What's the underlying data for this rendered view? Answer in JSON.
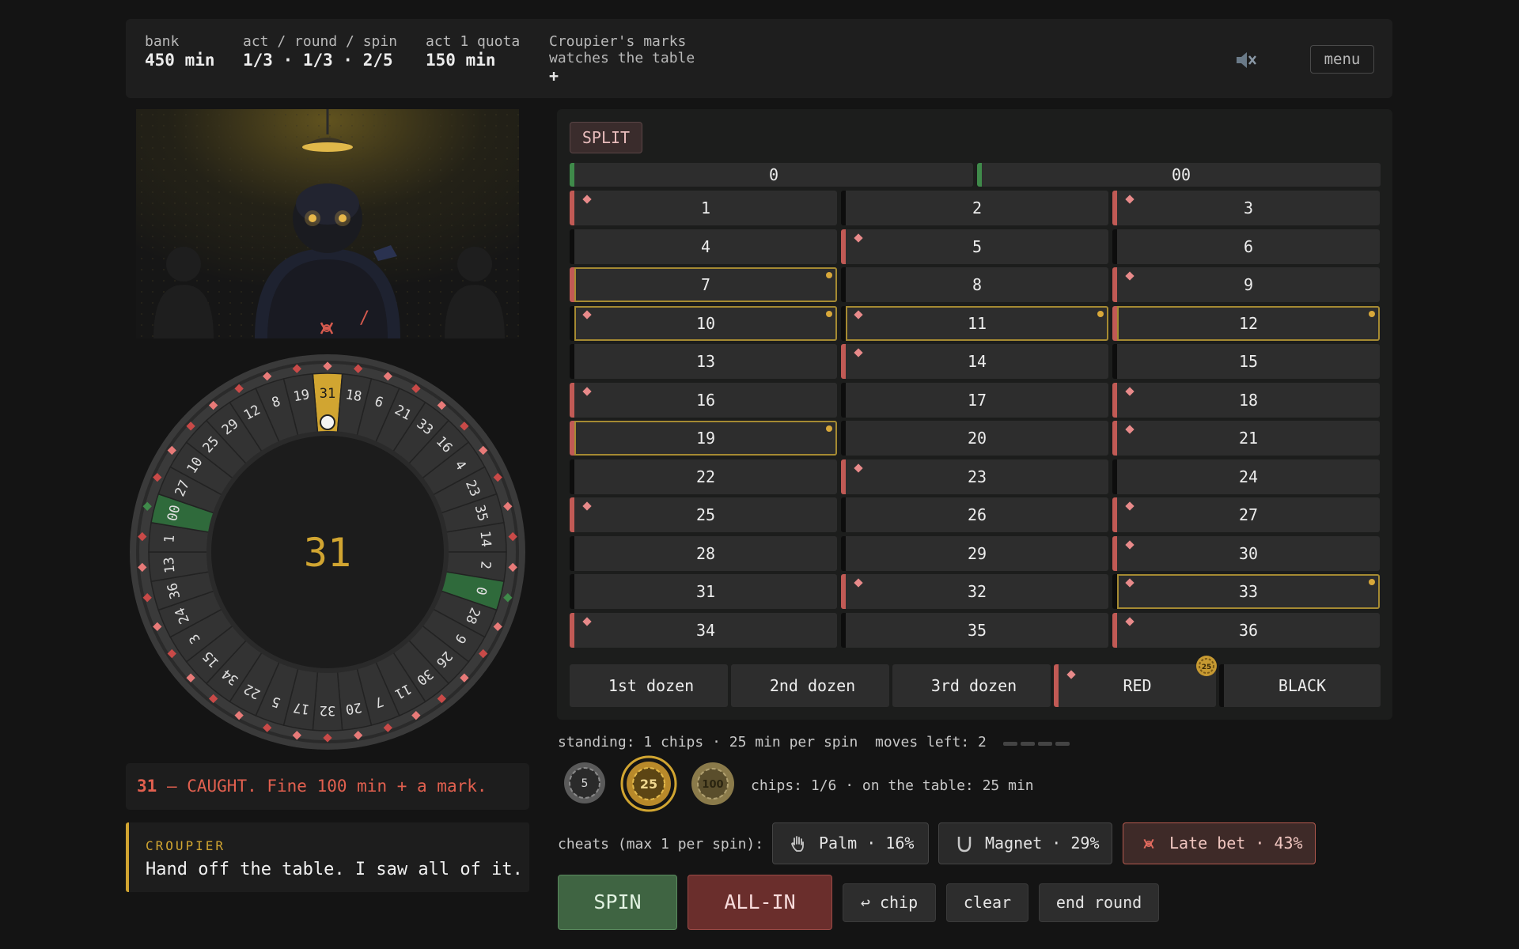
{
  "topbar": {
    "bank_label": "bank",
    "bank_value": "450 min",
    "progress_label": "act / round / spin",
    "progress_value": "1/3 · 1/3 · 2/5",
    "quota_label": "act 1 quota",
    "quota_value": "150 min",
    "marks_label": "Croupier's marks",
    "marks_status": "watches the table",
    "marks_symbol": "+",
    "sound_icon": "speaker-muted-icon",
    "menu_label": "menu"
  },
  "scene": {
    "late_bet_marker_icon": "late-bet-icon",
    "slash_text": "/"
  },
  "wheel": {
    "center_number": "31",
    "highlighted": "31",
    "pockets": [
      "31",
      "18",
      "6",
      "21",
      "33",
      "16",
      "4",
      "23",
      "35",
      "14",
      "2",
      "0",
      "28",
      "9",
      "26",
      "30",
      "11",
      "7",
      "20",
      "32",
      "17",
      "5",
      "22",
      "34",
      "15",
      "3",
      "24",
      "36",
      "13",
      "1",
      "00",
      "27",
      "10",
      "25",
      "29",
      "12",
      "8",
      "19"
    ],
    "greens": [
      "0",
      "00"
    ],
    "colors": {
      "gold": "#d1a531",
      "red": "#c94a48",
      "green": "#2f6a3b",
      "rim": "#3b3b3b"
    }
  },
  "result": {
    "number": "31",
    "text": " — CAUGHT. Fine 100 min + a mark."
  },
  "croupier": {
    "label": "CROUPIER",
    "line": "Hand off the table. I saw all of it."
  },
  "board": {
    "mode_label": "SPLIT",
    "zero": "0",
    "double_zero": "00",
    "cells": [
      {
        "n": "1",
        "color": "red",
        "mark": true,
        "sel": false
      },
      {
        "n": "2",
        "color": "black",
        "mark": false,
        "sel": false
      },
      {
        "n": "3",
        "color": "red",
        "mark": true,
        "sel": false
      },
      {
        "n": "4",
        "color": "black",
        "mark": false,
        "sel": false
      },
      {
        "n": "5",
        "color": "red",
        "mark": true,
        "sel": false
      },
      {
        "n": "6",
        "color": "black",
        "mark": false,
        "sel": false
      },
      {
        "n": "7",
        "color": "red",
        "mark": false,
        "sel": true
      },
      {
        "n": "8",
        "color": "black",
        "mark": false,
        "sel": false
      },
      {
        "n": "9",
        "color": "red",
        "mark": true,
        "sel": false
      },
      {
        "n": "10",
        "color": "black",
        "mark": true,
        "sel": true
      },
      {
        "n": "11",
        "color": "black",
        "mark": true,
        "sel": true
      },
      {
        "n": "12",
        "color": "red",
        "mark": false,
        "sel": true
      },
      {
        "n": "13",
        "color": "black",
        "mark": false,
        "sel": false
      },
      {
        "n": "14",
        "color": "red",
        "mark": true,
        "sel": false
      },
      {
        "n": "15",
        "color": "black",
        "mark": false,
        "sel": false
      },
      {
        "n": "16",
        "color": "red",
        "mark": true,
        "sel": false
      },
      {
        "n": "17",
        "color": "black",
        "mark": false,
        "sel": false
      },
      {
        "n": "18",
        "color": "red",
        "mark": true,
        "sel": false
      },
      {
        "n": "19",
        "color": "red",
        "mark": false,
        "sel": true
      },
      {
        "n": "20",
        "color": "black",
        "mark": false,
        "sel": false
      },
      {
        "n": "21",
        "color": "red",
        "mark": true,
        "sel": false
      },
      {
        "n": "22",
        "color": "black",
        "mark": false,
        "sel": false
      },
      {
        "n": "23",
        "color": "red",
        "mark": true,
        "sel": false
      },
      {
        "n": "24",
        "color": "black",
        "mark": false,
        "sel": false
      },
      {
        "n": "25",
        "color": "red",
        "mark": true,
        "sel": false
      },
      {
        "n": "26",
        "color": "black",
        "mark": false,
        "sel": false
      },
      {
        "n": "27",
        "color": "red",
        "mark": true,
        "sel": false
      },
      {
        "n": "28",
        "color": "black",
        "mark": false,
        "sel": false
      },
      {
        "n": "29",
        "color": "black",
        "mark": false,
        "sel": false
      },
      {
        "n": "30",
        "color": "red",
        "mark": true,
        "sel": false
      },
      {
        "n": "31",
        "color": "black",
        "mark": false,
        "sel": false
      },
      {
        "n": "32",
        "color": "red",
        "mark": true,
        "sel": false
      },
      {
        "n": "33",
        "color": "black",
        "mark": true,
        "sel": true
      },
      {
        "n": "34",
        "color": "red",
        "mark": true,
        "sel": false
      },
      {
        "n": "35",
        "color": "black",
        "mark": false,
        "sel": false
      },
      {
        "n": "36",
        "color": "red",
        "mark": true,
        "sel": false
      }
    ],
    "dozen1": "1st dozen",
    "dozen2": "2nd dozen",
    "dozen3": "3rd dozen",
    "red_label": "RED",
    "black_label": "BLACK",
    "red_chip": "25"
  },
  "status": {
    "standing": "standing: 1 chips · 25 min per spin",
    "moves": "moves left: 2"
  },
  "chips": {
    "values": [
      "5",
      "25",
      "100"
    ],
    "selected": "25",
    "info": "chips: 1/6 · on the table: 25 min"
  },
  "cheats": {
    "label": "cheats (max 1 per spin):",
    "palm": "Palm · 16%",
    "magnet": "Magnet · 29%",
    "late": "Late bet · 43%"
  },
  "actions": {
    "spin": "SPIN",
    "allin": "ALL-IN",
    "undo_chip": "↩ chip",
    "clear": "clear",
    "end_round": "end round"
  }
}
